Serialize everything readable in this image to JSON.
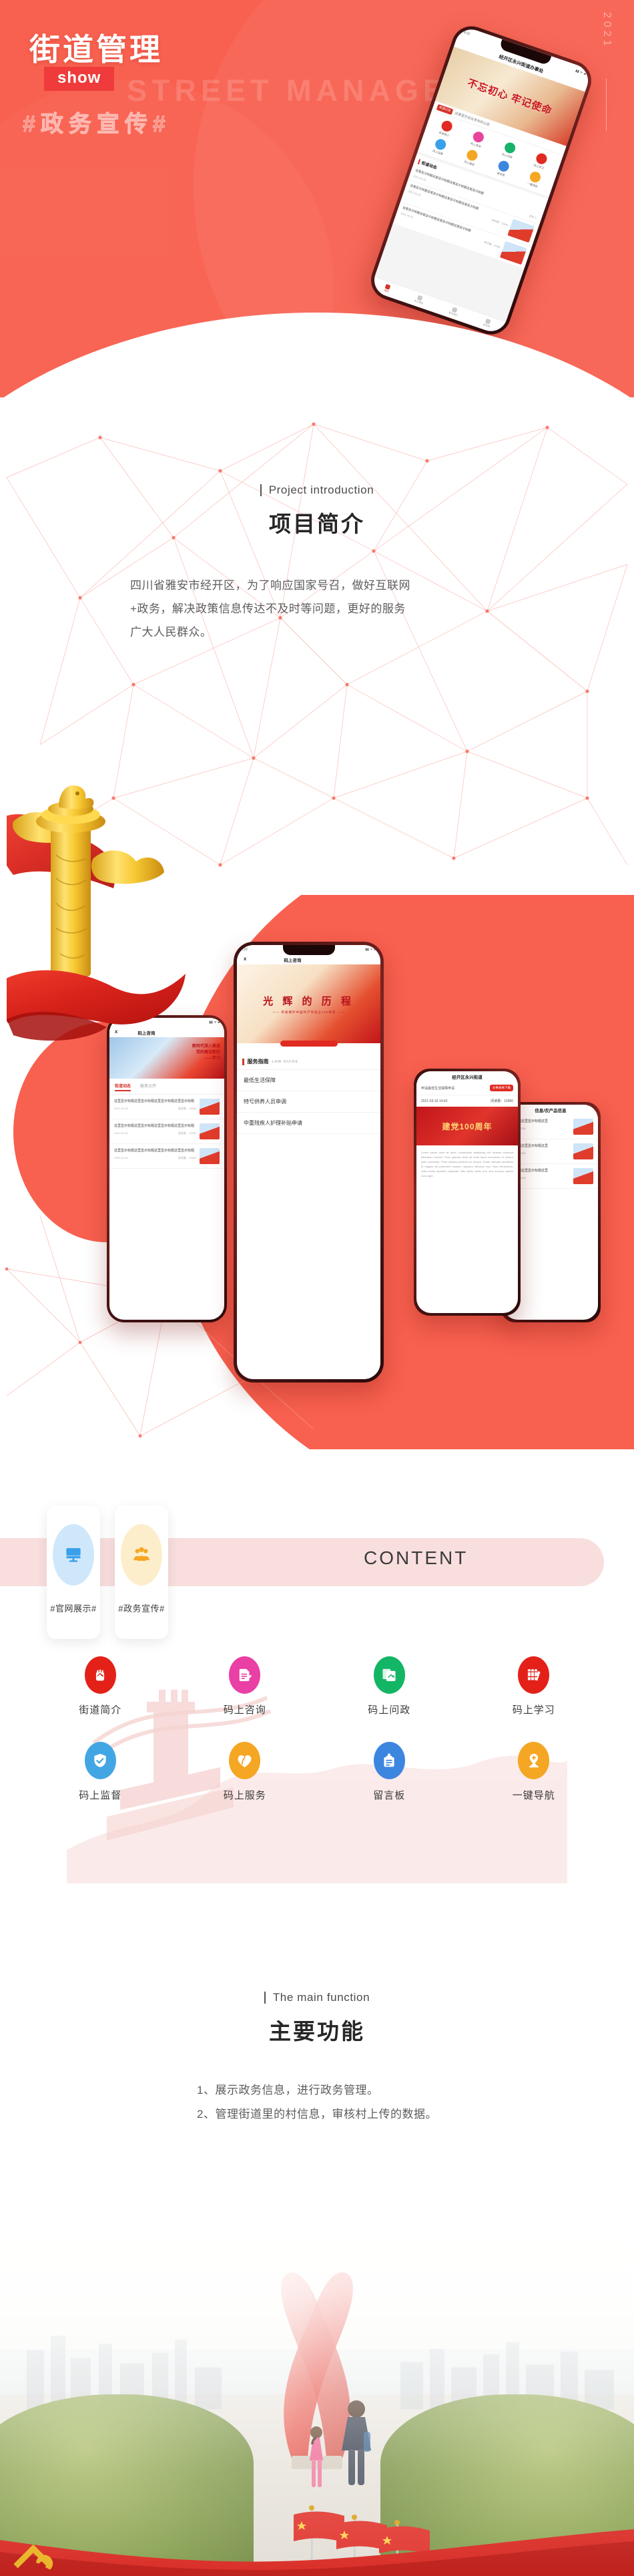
{
  "hero": {
    "year": "2021",
    "title": "街道管理",
    "badge": "show",
    "ghost_en": "STREET MANAGEMENT",
    "ghost_cn": "#政务宣传#",
    "phone": {
      "status_time": "4:22",
      "status_right": "",
      "navbar_title": "经开区永兴街道办事处",
      "banner_text": "不忘初心 牢记使命",
      "notice_tag": "街道公告",
      "notice_text": "这里显示后台发布的公告",
      "grid": [
        {
          "label": "街道简介",
          "color": "#e02a22"
        },
        {
          "label": "码上咨询",
          "color": "#e8449c"
        },
        {
          "label": "码上问政",
          "color": "#17b26a"
        },
        {
          "label": "码上学习",
          "color": "#e02a22"
        },
        {
          "label": "码上监督",
          "color": "#3aa0ea"
        },
        {
          "label": "码上服务",
          "color": "#f5a623"
        },
        {
          "label": "留言板",
          "color": "#3d86e0"
        },
        {
          "label": "一键导航",
          "color": "#f5a623"
        }
      ],
      "section_title": "街道动态",
      "more_label": "更多 》",
      "news": [
        {
          "title": "这里显示标题这里显示标题这里显示标题这里显示标题",
          "date": "2021-03-16",
          "views": "阅读量：12580"
        },
        {
          "title": "这里显示标题这里显示标题这里显示标题这里显示标题",
          "date": "2021-03-16",
          "views": "阅读量：12580"
        },
        {
          "title": "这里显示标题这里显示标题这里显示标题这里显示标题",
          "date": "2021-03-16",
          "views": "阅读量：12580"
        }
      ],
      "tabs": [
        {
          "label": "首页",
          "active": true
        },
        {
          "label": "码上服务",
          "active": false
        },
        {
          "label": "联系我们",
          "active": false
        },
        {
          "label": "留言板",
          "active": false
        }
      ]
    }
  },
  "intro": {
    "en_title": "Project introduction",
    "cn_title": "项目简介",
    "paragraph_lines": [
      "四川省雅安市经开区，为了响应国家号召，做好互联网",
      "+政务，解决政策信息传达不及时等问题，更好的服务",
      "广大人民群众。"
    ]
  },
  "showcase": {
    "phone_left": {
      "status_time": "4:22",
      "nav_title": "码上咨询",
      "close_label": "X",
      "banner_line1": "新时代深入推进",
      "banner_line2": "党的建设新的",
      "banner_line3": "——学习",
      "tabs": [
        {
          "label": "街道动态",
          "active": true
        },
        {
          "label": "政务公开",
          "active": false
        }
      ],
      "articles": [
        {
          "title": "这里显示标题这里显示标题这里显示标题这里显示标题",
          "date": "2021-03-16",
          "views": "阅读量：12580"
        },
        {
          "title": "这里显示标题这里显示标题这里显示标题这里显示标题",
          "date": "2021-03-16",
          "views": "阅读量：12580"
        },
        {
          "title": "这里显示标题这里显示标题这里显示标题这里显示标题",
          "date": "2021-03-16",
          "views": "阅读量：12580"
        }
      ]
    },
    "phone_center": {
      "status_time": "4:22",
      "close_label": "X",
      "nav_title": "码上咨询",
      "hero_title": "光 辉 的 历 程",
      "hero_sub": "—— 积极拥护中国共产党成立100周年 ——",
      "guide_cn": "服务指南",
      "guide_en": "LAW GUIDE",
      "items": [
        "最低生活保障",
        "特亏供养人员申调",
        "中重残疾人护理补贴申请"
      ]
    },
    "phone_right": {
      "nav_title": "经开区永兴街道",
      "row_label": "申请最低生活保障申请",
      "row_chip": "办事表格下载",
      "row_date": "2021-03-16  14:42",
      "row_views": "阅读量：12580",
      "banner_text": "建党100周年",
      "body_text": "Lorem ipsum dolor sit amet, consectetur adipiscing elit. Aenean euismod bibendum laoreet. Proin gravida dolor sit amet lacus accumsan et viverra justo commodo. Proin sodales pulvinar sic tempor. Sociis natoque penatibus et magnis dis parturient montes, nascetur ridiculus mus. Nam fermentum, nulla luctus pharetra vulputate, felis tellus mollis orci, sed rhoncus sapien nunc eget."
    },
    "phone_far_right": {
      "nav_title": "信息/农产品信息",
      "articles": [
        {
          "title": "显示标题这里显示标题这里",
          "views": "阅读量：12580"
        },
        {
          "title": "显示标题这里显示标题这里",
          "views": "阅读量：12580"
        },
        {
          "title": "显示标题这里显示标题这里",
          "views": "阅读量：12580"
        }
      ]
    }
  },
  "content": {
    "heading": "CONTENT",
    "cards": [
      {
        "label": "#官网展示#",
        "icon": "monitor-icon",
        "bg": "#cfe7fa",
        "fg": "#3aa0ea"
      },
      {
        "label": "#政务宣传#",
        "icon": "people-icon",
        "bg": "#fdeecb",
        "fg": "#f5a623"
      }
    ],
    "features": [
      {
        "label": "街道简介",
        "icon": "fist-party-icon",
        "color": "#e32119"
      },
      {
        "label": "码上咨询",
        "icon": "document-pencil-icon",
        "color": "#ea3fa4"
      },
      {
        "label": "码上问政",
        "icon": "party-card-icon",
        "color": "#13b665"
      },
      {
        "label": "码上学习",
        "icon": "books-icon",
        "color": "#e32119"
      },
      {
        "label": "码上监督",
        "icon": "shield-check-icon",
        "color": "#43a6e4"
      },
      {
        "label": "码上服务",
        "icon": "heart-hands-icon",
        "color": "#f5a623"
      },
      {
        "label": "留言板",
        "icon": "clipboard-icon",
        "color": "#3d86e0"
      },
      {
        "label": "一键导航",
        "icon": "location-pin-icon",
        "color": "#f5a623"
      }
    ]
  },
  "functions": {
    "en_title": "The main function",
    "cn_title": "主要功能",
    "items": [
      "1、展示政务信息，进行政务管理。",
      "2、管理街道里的村信息，审核村上传的数据。"
    ]
  },
  "colors": {
    "hero_red": "#f8604f",
    "badge_red": "#ef3b3b",
    "band_pink": "#f9dede",
    "text_dark": "#262626",
    "text_body": "#5c5c5c"
  }
}
